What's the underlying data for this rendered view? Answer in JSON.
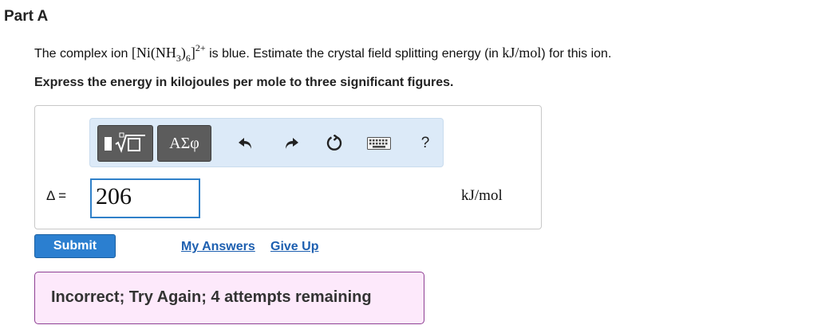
{
  "part_title": "Part A",
  "question": {
    "text_before": "The complex ion ",
    "formula": {
      "open": "[Ni(NH",
      "sub1": "3",
      "mid": ")",
      "sub2": "6",
      "close": "]",
      "charge": "2+"
    },
    "text_middle": " is blue. Estimate the crystal field splitting energy (in ",
    "unit": "kJ/mol",
    "text_after": ") for this ion."
  },
  "instruction": "Express the energy in kilojoules per mole to three significant figures.",
  "toolbar": {
    "templates_icon": "templates-icon",
    "symbols_label": "ΑΣφ",
    "undo_icon": "undo-icon",
    "redo_icon": "redo-icon",
    "reset_icon": "reset-icon",
    "keyboard_icon": "keyboard-icon",
    "help_label": "?"
  },
  "answer": {
    "label": "Δ =",
    "value": "206",
    "unit": "kJ/mol"
  },
  "buttons": {
    "submit": "Submit",
    "my_answers": "My Answers",
    "give_up": "Give Up"
  },
  "feedback": "Incorrect; Try Again; 4 attempts remaining",
  "colors": {
    "submit": "#2b7fd0",
    "link": "#1d5fb0",
    "input_border": "#2f80c9",
    "toolbar_bg": "#dceaf8",
    "feedback_bg": "#fde9fb",
    "feedback_border": "#8e3f93"
  }
}
